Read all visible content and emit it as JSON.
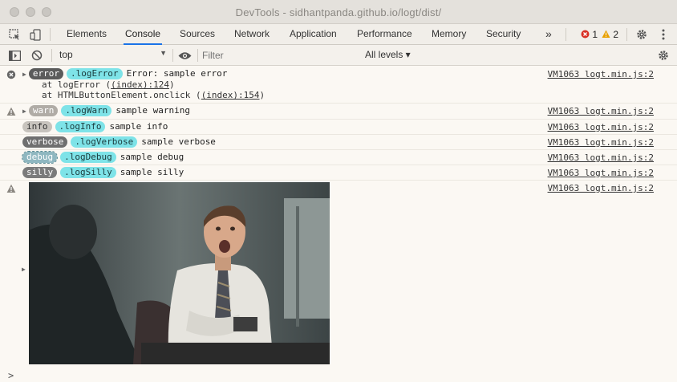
{
  "window": {
    "title": "DevTools - sidhantpanda.github.io/logt/dist/"
  },
  "tabs": [
    {
      "label": "Elements"
    },
    {
      "label": "Console"
    },
    {
      "label": "Sources"
    },
    {
      "label": "Network"
    },
    {
      "label": "Application"
    },
    {
      "label": "Performance"
    },
    {
      "label": "Memory"
    },
    {
      "label": "Security"
    }
  ],
  "tabs_overflow": "»",
  "counts": {
    "errors": "1",
    "warnings": "2"
  },
  "toolbar": {
    "context": "top",
    "filter_placeholder": "Filter",
    "levels": "All levels ▾"
  },
  "messages": {
    "error": {
      "level_label": "error",
      "method": ".logError",
      "text": "Error: sample error",
      "stack1_prefix": "at logError (",
      "stack1_link": "(index):124",
      "stack1_suffix": ")",
      "stack2_prefix": "at HTMLButtonElement.onclick (",
      "stack2_link": "(index):154",
      "stack2_suffix": ")",
      "source": "VM1063 logt.min.js:2"
    },
    "warn": {
      "level_label": "warn",
      "method": ".logWarn",
      "text": "sample warning",
      "source": "VM1063 logt.min.js:2"
    },
    "info": {
      "level_label": "info",
      "method": ".logInfo",
      "text": "sample info",
      "source": "VM1063 logt.min.js:2"
    },
    "verbose": {
      "level_label": "verbose",
      "method": ".logVerbose",
      "text": "sample verbose",
      "source": "VM1063 logt.min.js:2"
    },
    "debug": {
      "level_label": "debug",
      "method": ".logDebug",
      "text": "sample debug",
      "source": "VM1063 logt.min.js:2"
    },
    "silly": {
      "level_label": "silly",
      "method": ".logSilly",
      "text": "sample silly",
      "source": "VM1063 logt.min.js:2"
    },
    "image": {
      "source": "VM1063 logt.min.js:2"
    }
  },
  "prompt": {
    "symbol": ">"
  },
  "icons": {
    "inspect": "inspect-element-icon",
    "device": "device-toolbar-icon",
    "settings": "gear-icon",
    "more": "vertical-dots-icon",
    "sidebar": "sidebar-toggle-icon",
    "clear": "clear-console-icon",
    "eye": "live-expression-eye-icon"
  },
  "colors": {
    "accent": "#1a73e8",
    "error": "#d93025",
    "warning": "#e8a000"
  }
}
